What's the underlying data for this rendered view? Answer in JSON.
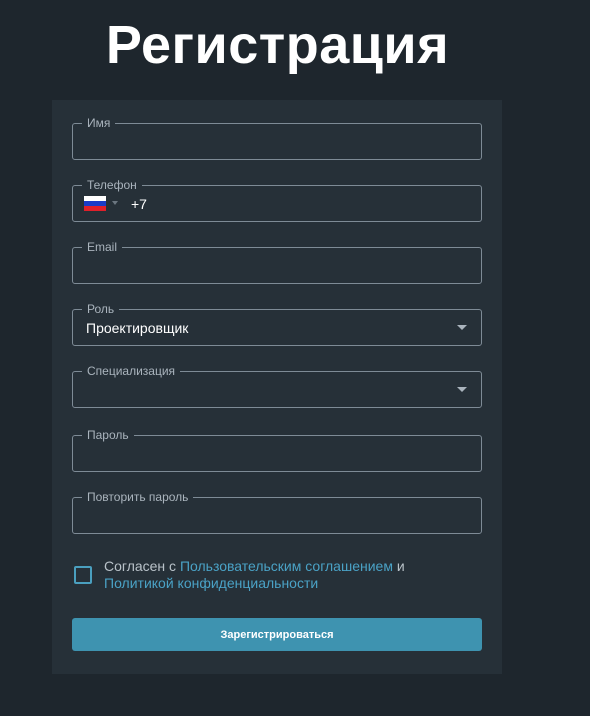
{
  "page": {
    "title": "Регистрация"
  },
  "form": {
    "name": {
      "label": "Имя",
      "value": ""
    },
    "phone": {
      "label": "Телефон",
      "country_code": "+7",
      "flag": "russia-flag-icon"
    },
    "email": {
      "label": "Email",
      "value": ""
    },
    "role": {
      "label": "Роль",
      "value": "Проектировщик"
    },
    "specialization": {
      "label": "Специализация",
      "value": ""
    },
    "password": {
      "label": "Пароль",
      "value": ""
    },
    "repeat_password": {
      "label": "Повторить пароль",
      "value": ""
    },
    "agreement": {
      "text_prefix": "Согласен с ",
      "terms_link": "Пользовательским соглашением",
      "conjunction": " и ",
      "privacy_link": "Политикой конфиденциальности"
    },
    "submit_label": "Зарегистрироваться"
  },
  "colors": {
    "background": "#1e262d",
    "card": "#263038",
    "accent": "#3e93b0",
    "link": "#4aa2c6"
  }
}
